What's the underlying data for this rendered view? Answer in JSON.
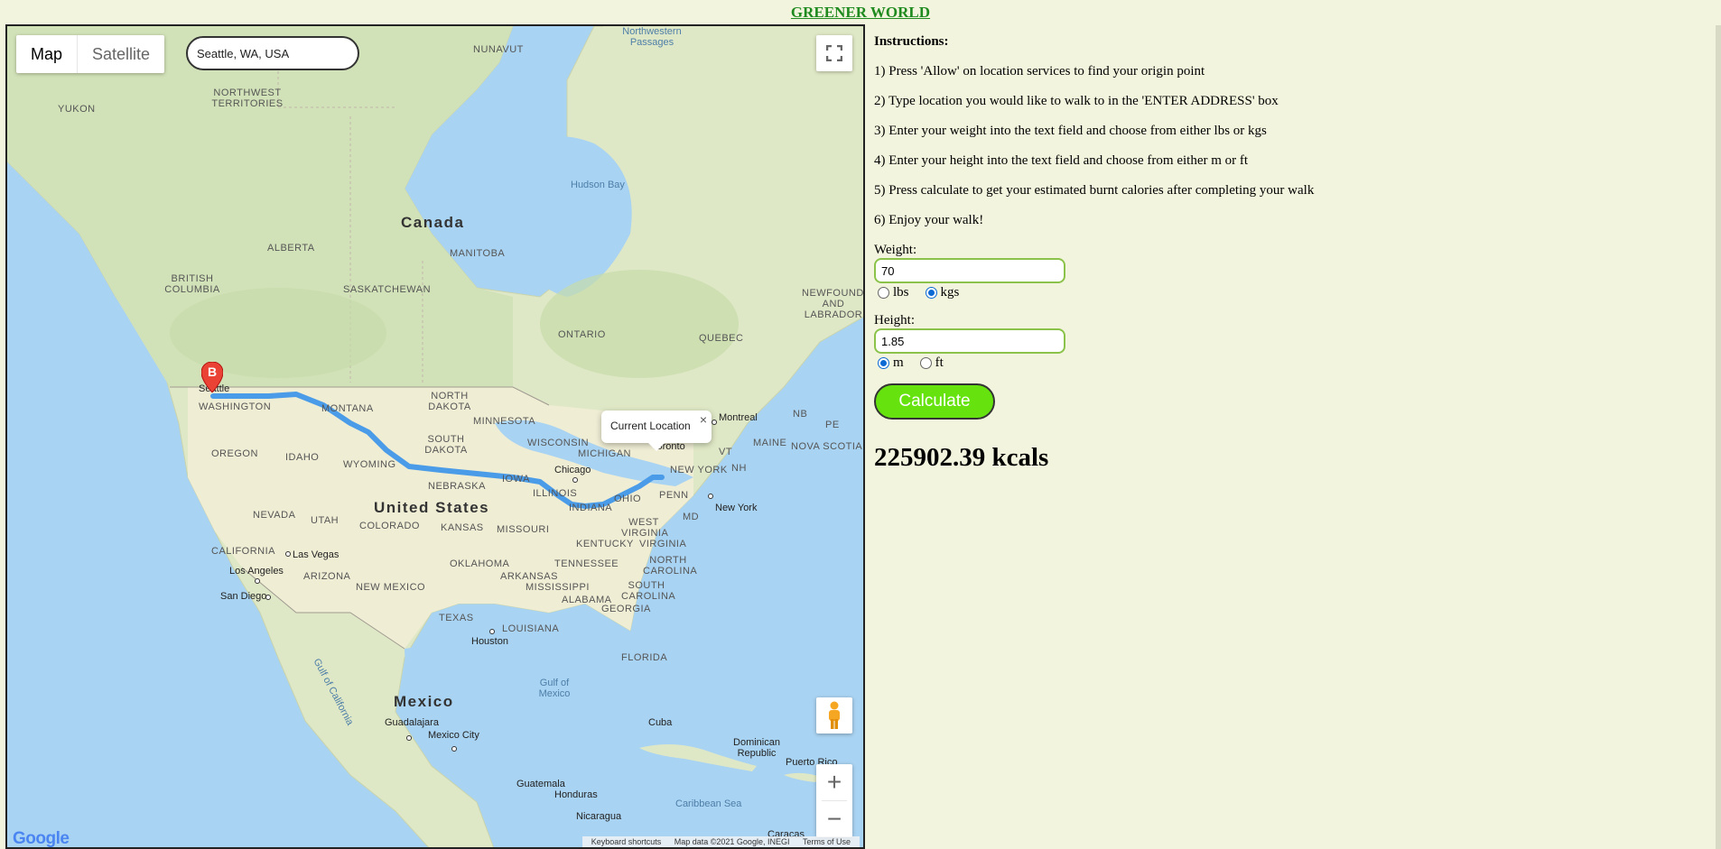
{
  "site": {
    "title": "GREENER WORLD"
  },
  "map": {
    "type_buttons": [
      "Map",
      "Satellite"
    ],
    "search_value": "Seattle, WA, USA",
    "info_window": "Current Location",
    "marker_label": "B",
    "attribution": [
      "Keyboard shortcuts",
      "Map data ©2021 Google, INEGI",
      "Terms of Use"
    ],
    "logo": "Google",
    "labels": {
      "countries": [
        "Canada",
        "United States",
        "Mexico"
      ],
      "regions": [
        "NUNAVUT",
        "YUKON",
        "NORTHWEST TERRITORIES",
        "ALBERTA",
        "BRITISH COLUMBIA",
        "SASKATCHEWAN",
        "MANITOBA",
        "ONTARIO",
        "QUEBEC",
        "NEWFOUNDLAND AND LABRADOR",
        "WASHINGTON",
        "OREGON",
        "IDAHO",
        "MONTANA",
        "WYOMING",
        "NORTH DAKOTA",
        "SOUTH DAKOTA",
        "MINNESOTA",
        "WISCONSIN",
        "MICHIGAN",
        "NEBRASKA",
        "IOWA",
        "ILLINOIS",
        "INDIANA",
        "OHIO",
        "PENN",
        "NEW YORK",
        "VT",
        "NH",
        "MAINE",
        "NB",
        "PE",
        "NOVA SCOTIA",
        "MD",
        "NEVADA",
        "UTAH",
        "COLORADO",
        "KANSAS",
        "MISSOURI",
        "KENTUCKY",
        "WEST VIRGINIA",
        "VIRGINIA",
        "CALIFORNIA",
        "ARIZONA",
        "NEW MEXICO",
        "OKLAHOMA",
        "ARKANSAS",
        "TENNESSEE",
        "NORTH CAROLINA",
        "SOUTH CAROLINA",
        "MISSISSIPPI",
        "ALABAMA",
        "GEORGIA",
        "TEXAS",
        "LOUISIANA",
        "FLORIDA"
      ],
      "water": [
        "Hudson Bay",
        "Gulf of Mexico",
        "Gulf of California",
        "Caribbean Sea",
        "Northwestern Passages"
      ],
      "cities": [
        "Seattle",
        "Chicago",
        "Toronto",
        "Montreal",
        "New York",
        "Las Vegas",
        "Los Angeles",
        "San Diego",
        "Houston",
        "Guadalajara",
        "Mexico City",
        "Cuba",
        "Dominican Republic",
        "Puerto Rico",
        "Guatemala",
        "Honduras",
        "Nicaragua",
        "Caracas"
      ]
    }
  },
  "panel": {
    "instructions_heading": "Instructions:",
    "steps": [
      "1) Press 'Allow' on location services to find your origin point",
      "2) Type location you would like to walk to in the 'ENTER ADDRESS' box",
      "3) Enter your weight into the text field and choose from either lbs or kgs",
      "4) Enter your height into the text field and choose from either m or ft",
      "5) Press calculate to get your estimated burnt calories after completing your walk",
      "6) Enjoy your walk!"
    ],
    "weight": {
      "label": "Weight:",
      "value": "70",
      "units": [
        "lbs",
        "kgs"
      ],
      "selected": "kgs"
    },
    "height": {
      "label": "Height:",
      "value": "1.85",
      "units": [
        "m",
        "ft"
      ],
      "selected": "m"
    },
    "calculate_label": "Calculate",
    "result": "225902.39 kcals"
  },
  "colors": {
    "title": "#1f8a1f",
    "button": "#66e30f",
    "route": "#4a9be8",
    "water": "#a9d3f2",
    "land": "#e8edd6"
  }
}
